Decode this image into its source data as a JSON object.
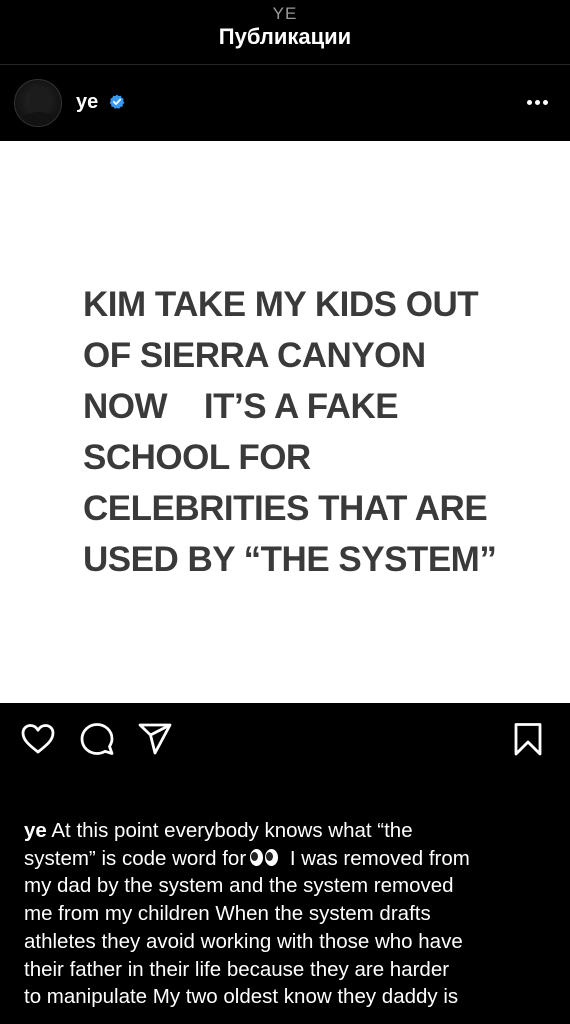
{
  "header": {
    "account_name": "YE",
    "title": "Публикации"
  },
  "post": {
    "username": "ye",
    "image_text_lines": [
      "KIM TAKE MY KIDS OUT",
      "OF SIERRA CANYON",
      "NOW    IT’S A FAKE",
      "SCHOOL FOR",
      "CELEBRITIES THAT ARE",
      "USED BY “THE SYSTEM”"
    ],
    "caption": {
      "username": "ye",
      "line_1": " At this point everybody knows what “the",
      "line_2_before_emoji": "system” is code word for",
      "line_2_after_emoji": " I was removed from",
      "line_3": "my dad by the system and the system removed",
      "line_4": "me from my children  When the system drafts",
      "line_5": "athletes they avoid working with those who have",
      "line_6": "their father in their life because they are harder",
      "line_7": "to manipulate  My two oldest know they daddy is"
    }
  },
  "icons": {
    "like": "heart-icon",
    "comment": "comment-bubble-icon",
    "share": "paper-plane-icon",
    "save": "bookmark-icon",
    "more": "more-options-icon",
    "verified": "verified-badge-icon",
    "emoji": "eyes-emoji"
  },
  "colors": {
    "background": "#000000",
    "verified_badge": "#3897f0",
    "image_background": "#ffffff",
    "image_text": "#3a3a3a",
    "account_name": "#9a9a9a"
  }
}
